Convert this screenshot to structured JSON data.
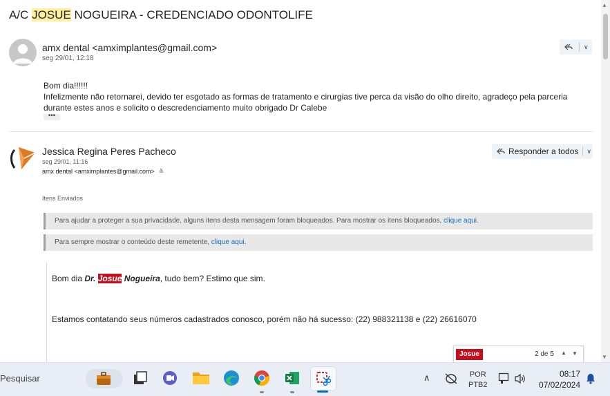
{
  "email": {
    "subject_prefix": "A/C ",
    "subject_highlight": "JOSUE",
    "subject_rest": " NOGUEIRA - CREDENCIADO ODONTOLIFE"
  },
  "message1": {
    "sender": "amx dental <amximplantes@gmail.com>",
    "date": "seg 29/01, 12:18",
    "greeting": "Bom dia!!!!!!",
    "body": "Infelizmente não retornarei, devido ter esgotado as formas de tratamento e cirurgias tive perca da visão do olho direito, agradeço pela parceria durante estes anos e solicito o descredenciamento muito obrigado Dr Calebe",
    "ellipsis": "•••"
  },
  "message2": {
    "sender": "Jessica Regina Peres Pacheco",
    "date": "seg 29/01, 11:16",
    "recipient": "amx dental <amximplantes@gmail.com>",
    "folder": "Itens Enviados",
    "reply_all_label": "Responder a todos",
    "notice1_text": "Para ajudar a proteger a sua privacidade, alguns itens desta mensagem foram bloqueados. Para mostrar os itens bloqueados, ",
    "notice1_link": "clique aqui.",
    "notice2_text": "Para sempre mostrar o conteúdo deste remetente, ",
    "notice2_link": "clique aqui.",
    "body_greeting_pre": "Bom dia ",
    "body_dr": "Dr.",
    "body_name_highlight": "Josue",
    "body_surname": "Nogueira",
    "body_greeting_post": ", tudo bem? Estimo que sim.",
    "body_line2": "Estamos contatando seus números cadastrados conosco, porém não há sucesso: (22) 988321138 e (22) 26616070"
  },
  "find_bar": {
    "term": "Josue",
    "count": "2 de 5"
  },
  "taskbar": {
    "search_placeholder": "Pesquisar",
    "language_top": "POR",
    "language_bottom": "PTB2",
    "time": "08:17",
    "date": "07/02/2024"
  },
  "colors": {
    "highlight": "#fff0a0",
    "find_highlight": "#c50f1f",
    "link": "#0f6cbd"
  }
}
